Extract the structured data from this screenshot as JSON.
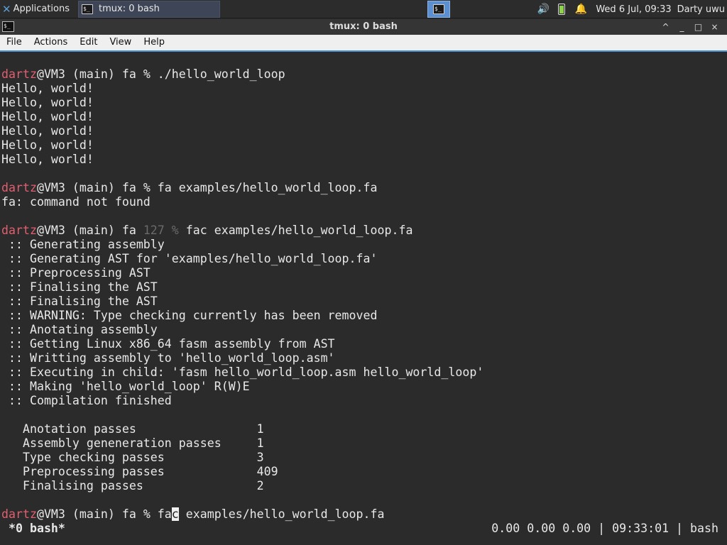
{
  "panel": {
    "applications_label": "Applications",
    "task_label": "tmux: 0 bash",
    "clock": "Wed  6 Jul, 09:33",
    "user": "Darty uwu",
    "icons": [
      "xfce-logo-icon",
      "terminal-icon",
      "volume-icon",
      "battery-icon",
      "notification-bell-icon"
    ]
  },
  "window": {
    "title": "tmux: 0 bash",
    "buttons": [
      "^",
      "_",
      "□",
      "×"
    ]
  },
  "menu": [
    "File",
    "Actions",
    "Edit",
    "View",
    "Help"
  ],
  "terminal": {
    "prompt_user": "dartz",
    "prompt_host": "@VM3 (main) fa ",
    "block1": {
      "prompt_tail": "% ./hello_world_loop",
      "output": [
        "Hello, world!",
        "Hello, world!",
        "Hello, world!",
        "Hello, world!",
        "Hello, world!",
        "Hello, world!"
      ]
    },
    "block2": {
      "prompt_tail": "% fa examples/hello_world_loop.fa",
      "output": [
        "fa: command not found"
      ]
    },
    "block3": {
      "exit_code": "127 %",
      "command": " fac examples/hello_world_loop.fa",
      "output": [
        " :: Generating assembly",
        " :: Generating AST for 'examples/hello_world_loop.fa'",
        " :: Preprocessing AST",
        " :: Finalising the AST",
        " :: Finalising the AST",
        " :: WARNING: Type checking currently has been removed",
        " :: Anotating assembly",
        " :: Getting Linux x86_64 fasm assembly from AST",
        " :: Writting assembly to 'hello_world_loop.asm'",
        " :: Executing in child: 'fasm hello_world_loop.asm hello_world_loop'",
        " :: Making 'hello_world_loop' R(W)E",
        " :: Compilation finished"
      ],
      "stats": [
        {
          "label": "   Anotation passes                 ",
          "value": "1"
        },
        {
          "label": "   Assembly geneneration passes     ",
          "value": "1"
        },
        {
          "label": "   Type checking passes             ",
          "value": "3"
        },
        {
          "label": "   Preprocessing passes             ",
          "value": "409"
        },
        {
          "label": "   Finalising passes                ",
          "value": "2"
        }
      ]
    },
    "current": {
      "before_cursor": "% fa",
      "cursor_char": "c",
      "after_cursor": " examples/hello_world_loop.fa"
    },
    "status": {
      "left": " *0 bash*",
      "right": "0.00 0.00 0.00 | 09:33:01 | bash"
    }
  }
}
